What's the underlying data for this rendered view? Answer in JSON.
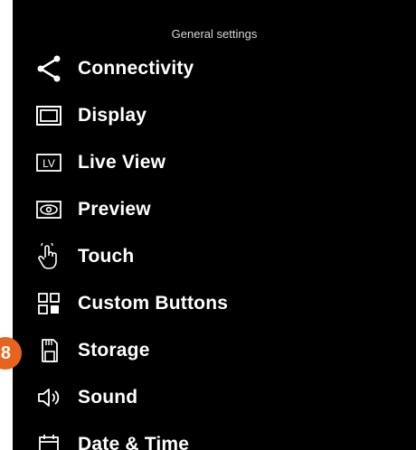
{
  "header": {
    "title": "General settings"
  },
  "menu": {
    "items": [
      {
        "label": "Connectivity",
        "icon": "share-icon"
      },
      {
        "label": "Display",
        "icon": "display-icon"
      },
      {
        "label": "Live View",
        "icon": "live-view-icon"
      },
      {
        "label": "Preview",
        "icon": "eye-icon"
      },
      {
        "label": "Touch",
        "icon": "hand-touch-icon"
      },
      {
        "label": "Custom Buttons",
        "icon": "grid-icon"
      },
      {
        "label": "Storage",
        "icon": "sd-card-icon"
      },
      {
        "label": "Sound",
        "icon": "speaker-icon"
      },
      {
        "label": "Date & Time",
        "icon": "calendar-icon"
      }
    ]
  },
  "badge": {
    "number": "8",
    "color": "#e8641e"
  }
}
